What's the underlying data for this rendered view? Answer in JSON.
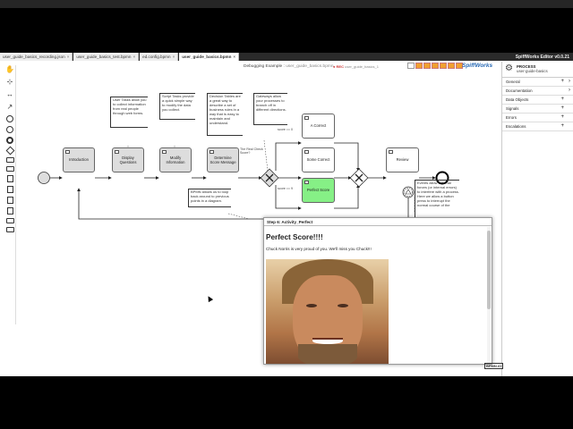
{
  "tabs": [
    {
      "label": "user_guide_basics_recording.json",
      "active": false
    },
    {
      "label": "user_guide_basics_test.bpmn",
      "active": false
    },
    {
      "label": "ed.config.bpmn",
      "active": false
    },
    {
      "label": "user_guide_basics.bpmn",
      "active": true
    }
  ],
  "app_title": "SpiffWorks Editor v0.0.21",
  "canvas": {
    "title": "Debugging Example : ",
    "subtitle": "user_guide_basics.bpmn",
    "rec_label": "● REC",
    "rec_file": "user_guide_basics_1",
    "brand": "SpiffWorks"
  },
  "side_panel": {
    "process_label": "PROCESS",
    "process_name": "user-guide-basics",
    "rows": [
      {
        "label": "General",
        "plus": "+",
        "arrow": "›"
      },
      {
        "label": "Documentation",
        "plus": "",
        "arrow": "›"
      },
      {
        "label": "Data Objects",
        "plus": "+",
        "arrow": ""
      },
      {
        "label": "Signals",
        "plus": "+",
        "arrow": ""
      },
      {
        "label": "Errors",
        "plus": "+",
        "arrow": ""
      },
      {
        "label": "Escalations",
        "plus": "+",
        "arrow": ""
      }
    ]
  },
  "tasks": {
    "introduction": "Introduction",
    "display_questions": "Display Questions",
    "modify_information": "Modify Information",
    "determine_score": "Determine Score Message",
    "correct": "A Correct",
    "some_correct": "Some Correct",
    "perfect_score": "Perfect Score",
    "review": "Review"
  },
  "annotations": {
    "user_tasks": "User Tasks allow you to collect information from real people through web forms.",
    "script_tasks": "Script Tasks provide a quick simple way to modify the data you collect.",
    "decision_tables": "Decision Tables are a great way to describe a set of business rules in a way that is easy to maintain and understand.",
    "gateways": "Gateways allow your processes to branch off in different directions.",
    "bpmn_loop": "BPMN allows us to loop back around to previous points in a diagram.",
    "events": "Events allow external forces (or internal errors) to interfere with a process. Here we allow a button press to interrupt the normal course of the"
  },
  "gateway_label": "The Real Check Score?",
  "flow_labels": {
    "f1": "score == 0",
    "f2": "score == 9"
  },
  "popup": {
    "header": "Step 6: Activity_Perfect",
    "title": "Perfect Score!!!!",
    "message": "Chuck Norris is very proud of you. We'll miss you Chuck!!!"
  },
  "footer_logo": "BPMN.iO"
}
